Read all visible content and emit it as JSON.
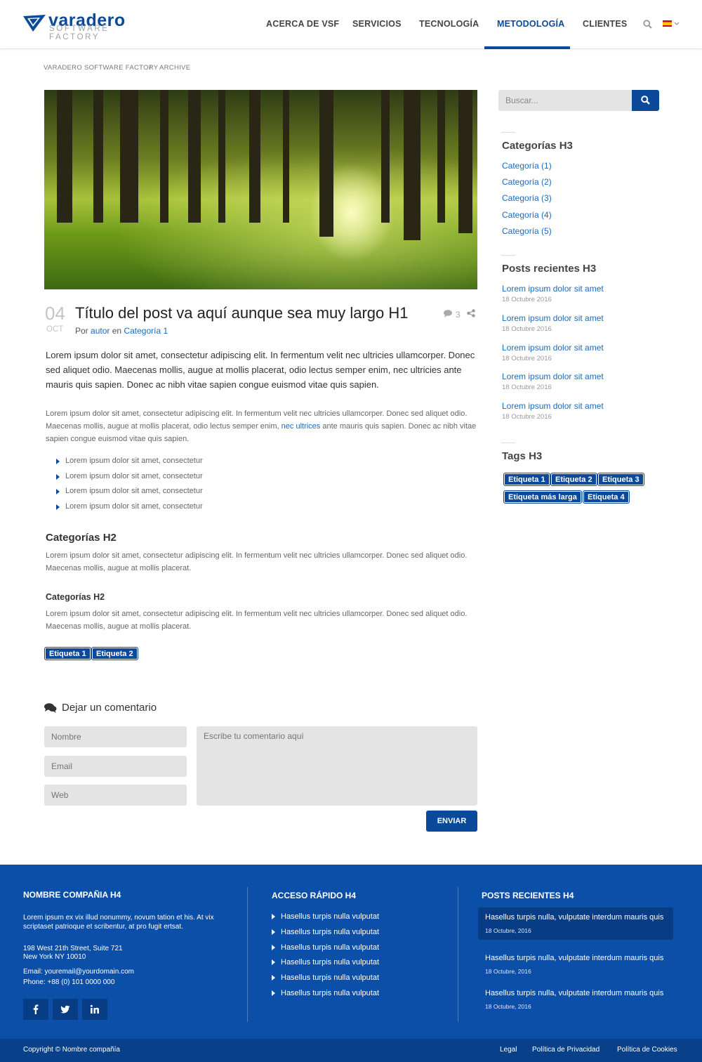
{
  "header": {
    "logo_word": "varadero",
    "logo_sub": "SOFTWARE FACTORY",
    "nav": [
      "ACERCA DE VSF",
      "SERVICIOS",
      "TECNOLOGÍA",
      "METODOLOGÍA",
      "CLIENTES"
    ],
    "active_nav": "METODOLOGÍA"
  },
  "breadcrumb": {
    "home": "VARADERO SOFTWARE FACTORY",
    "separator": "/",
    "current": "ARCHIVE"
  },
  "post": {
    "day": "04",
    "month": "OCT",
    "title": "Título del post va aquí aunque sea muy largo H1",
    "comments_count": "3",
    "meta_by": "Por",
    "author": "autor",
    "meta_in": "en",
    "category": "Categoría 1",
    "lead": "Lorem ipsum dolor sit amet, consectetur adipiscing elit. In fermentum velit nec ultricies ullamcorper. Donec sed aliquet odio. Maecenas mollis, augue at mollis placerat, odio lectus semper enim, nec ultricies ante mauris quis sapien. Donec ac nibh vitae sapien congue euismod vitae quis sapien.",
    "para1_a": "Lorem ipsum dolor sit amet, consectetur adipiscing elit. In fermentum velit nec ultricies ullamcorper. Donec sed aliquet odio. Maecenas mollis, augue at mollis placerat, odio lectus semper enim, ",
    "para1_link": "nec ultrices",
    "para1_b": " ante mauris quis sapien. Donec ac nibh vitae sapien congue euismod vitae quis sapien.",
    "bullets": [
      "Lorem ipsum dolor sit amet, consectetur",
      "Lorem ipsum dolor sit amet, consectetur",
      "Lorem ipsum dolor sit amet, consectetur",
      "Lorem ipsum dolor sit amet, consectetur"
    ],
    "h2_a": "Categorías H2",
    "para2": "Lorem ipsum dolor sit amet, consectetur adipiscing elit. In fermentum velit nec ultricies ullamcorper. Donec sed aliquet odio. Maecenas mollis, augue at mollis placerat.",
    "h2_b": "Categorías H2",
    "para3": "Lorem ipsum dolor sit amet, consectetur adipiscing elit. In fermentum velit nec ultricies ullamcorper. Donec sed aliquet odio. Maecenas mollis, augue at mollis placerat.",
    "tags": [
      "Etiqueta 1",
      "Etiqueta 2"
    ]
  },
  "comments": {
    "title": "Dejar un comentario",
    "name_placeholder": "Nombre",
    "email_placeholder": "Email",
    "web_placeholder": "Web",
    "comment_placeholder": "Escribe tu comentario aquí",
    "submit": "ENVIAR"
  },
  "sidebar": {
    "search_placeholder": "Buscar...",
    "categories_title": "Categorías H3",
    "categories": [
      "Categoría (1)",
      "Categoría (2)",
      "Categoría (3)",
      "Categoría (4)",
      "Categoría (5)"
    ],
    "recent_title": "Posts recientes H3",
    "recent": [
      {
        "title": "Lorem ipsum dolor sit amet",
        "date": "18 Octubre 2016"
      },
      {
        "title": "Lorem ipsum dolor sit amet",
        "date": "18 Octubre 2016"
      },
      {
        "title": "Lorem ipsum dolor sit amet",
        "date": "18 Octubre 2016"
      },
      {
        "title": "Lorem ipsum dolor sit amet",
        "date": "18 Octubre 2016"
      },
      {
        "title": "Lorem ipsum dolor sit amet",
        "date": "18 Octubre 2016"
      }
    ],
    "tags_title": "Tags H3",
    "tags": [
      "Etiqueta 1",
      "Etiqueta 2",
      "Etiqueta 3",
      "Etiqueta más larga",
      "Etiqueta 4"
    ]
  },
  "footer": {
    "company_title": "NOMBRE COMPAÑIA H4",
    "company_text": "Lorem ipsum ex vix illud nonummy, novum tation et his. At vix scriptaset patrioque et scribentur, at pro fugit ertsat.",
    "address_1": "198 West 21th Street, Suite 721",
    "address_2": "New York NY 10010",
    "email": "Email: youremail@yourdomain.com",
    "phone": "Phone: +88 (0) 101 0000 000",
    "quick_title": "ACCESO RÁPIDO H4",
    "quick_links": [
      "Hasellus turpis nulla  vulputat",
      "Hasellus turpis nulla  vulputat",
      "Hasellus turpis nulla  vulputat",
      "Hasellus turpis nulla  vulputat",
      "Hasellus turpis nulla  vulputat",
      "Hasellus turpis nulla  vulputat"
    ],
    "recent_title": "POSTS RECIENTES H4",
    "recent": [
      {
        "title": "Hasellus turpis nulla, vulputate interdum mauris quis",
        "date": "18 Octubre, 2016"
      },
      {
        "title": "Hasellus turpis nulla, vulputate interdum mauris quis",
        "date": "18 Octubre, 2016"
      },
      {
        "title": "Hasellus turpis nulla, vulputate interdum mauris quis",
        "date": "18 Octubre, 2016"
      }
    ],
    "copyright": "Copyright © Nombre compañía",
    "bottom_links": [
      "Legal",
      "Política de Privacidad",
      "Política de Cookies"
    ]
  },
  "colors": {
    "brand": "#0b4a9a",
    "footer": "#0b4fa8",
    "link": "#1a6bbf"
  }
}
